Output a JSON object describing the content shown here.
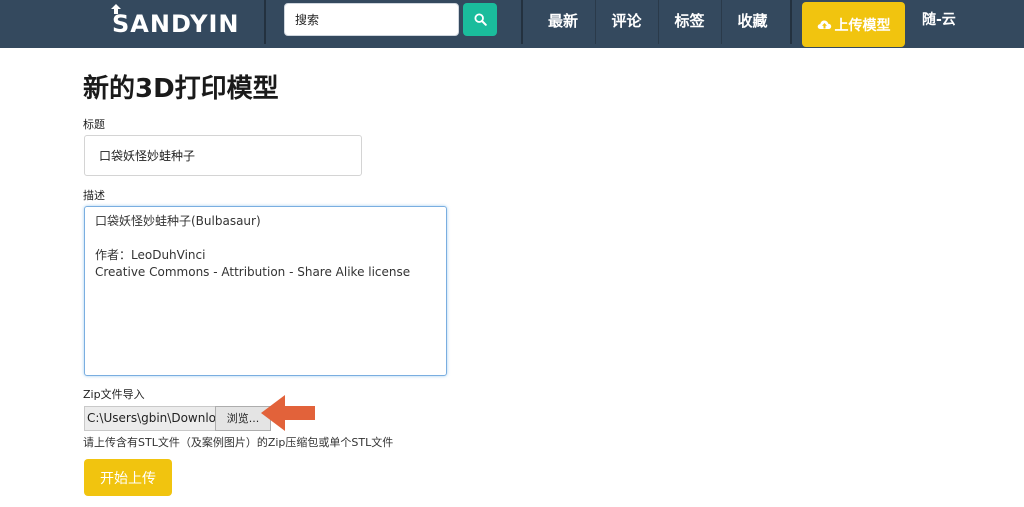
{
  "brand": {
    "name": "SANDYIN"
  },
  "search": {
    "placeholder": "搜索"
  },
  "nav": {
    "items": [
      {
        "label": "最新"
      },
      {
        "label": "评论"
      },
      {
        "label": "标签"
      },
      {
        "label": "收藏"
      }
    ],
    "upload_label": "上传模型",
    "user_name": "随-云"
  },
  "colors": {
    "navbar": "#34495e",
    "search_button": "#1abc9c",
    "accent": "#f1c40f",
    "annotation_arrow": "#e2623a"
  },
  "icons": {
    "search": "search-icon",
    "upload": "cloud-upload-icon",
    "logo": "upload-arrow-icon",
    "pointer": "arrow-left-annotation"
  },
  "form": {
    "page_title": "新的3D打印模型",
    "title_label": "标题",
    "title_value": "口袋妖怪妙蛙种子",
    "description_label": "描述",
    "description_value": "口袋妖怪妙蛙种子(Bulbasaur)\n\n作者：LeoDuhVinci\nCreative Commons - Attribution - Share Alike license",
    "zip_label": "Zip文件导入",
    "file_path": "C:\\Users\\gbin\\Downlo",
    "browse_label": "浏览...",
    "hint": "请上传含有STL文件（及案例图片）的Zip压缩包或单个STL文件",
    "submit_label": "开始上传"
  }
}
